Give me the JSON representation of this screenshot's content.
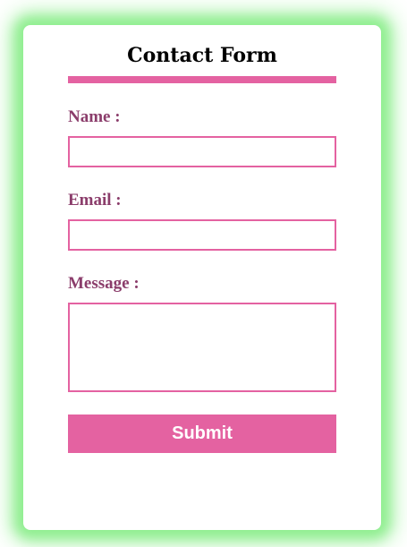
{
  "form": {
    "title": "Contact Form",
    "name_label": "Name :",
    "name_value": "",
    "email_label": "Email :",
    "email_value": "",
    "message_label": "Message :",
    "message_value": "",
    "submit_label": "Submit"
  },
  "colors": {
    "accent": "#e462a1",
    "label_text": "#8b3d6b",
    "glow": "#8fee8f",
    "background": "#ffffff"
  }
}
